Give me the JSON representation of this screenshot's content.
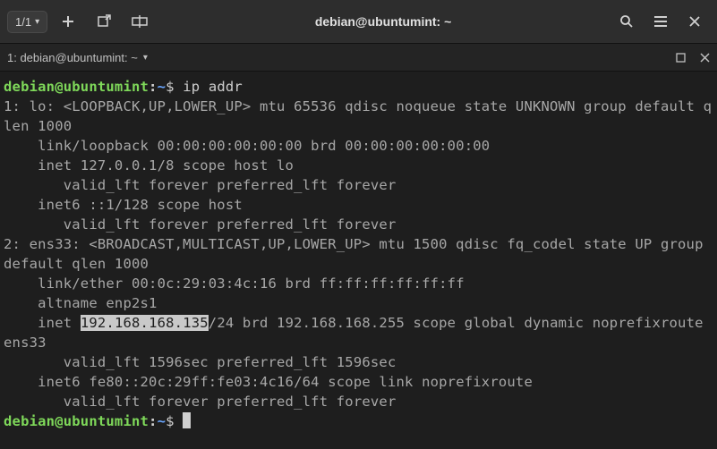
{
  "titlebar": {
    "tab_count": "1/1",
    "title": "debian@ubuntumint: ~"
  },
  "tabbar": {
    "label": "1: debian@ubuntumint: ~"
  },
  "prompt": {
    "user_host": "debian@ubuntumint",
    "path": "~",
    "dollar": "$"
  },
  "cmd1": "ip addr",
  "out": {
    "l1": "1: lo: <LOOPBACK,UP,LOWER_UP> mtu 65536 qdisc noqueue state UNKNOWN group default qlen 1000",
    "l2": "    link/loopback 00:00:00:00:00:00 brd 00:00:00:00:00:00",
    "l3": "    inet 127.0.0.1/8 scope host lo",
    "l4": "       valid_lft forever preferred_lft forever",
    "l5": "    inet6 ::1/128 scope host",
    "l6": "       valid_lft forever preferred_lft forever",
    "l7": "2: ens33: <BROADCAST,MULTICAST,UP,LOWER_UP> mtu 1500 qdisc fq_codel state UP group default qlen 1000",
    "l8": "    link/ether 00:0c:29:03:4c:16 brd ff:ff:ff:ff:ff:ff",
    "l9": "    altname enp2s1",
    "l10a": "    inet ",
    "l10_hl": "192.168.168.135",
    "l10b": "/24 brd 192.168.168.255 scope global dynamic noprefixroute ens33",
    "l11": "       valid_lft 1596sec preferred_lft 1596sec",
    "l12": "    inet6 fe80::20c:29ff:fe03:4c16/64 scope link noprefixroute",
    "l13": "       valid_lft forever preferred_lft forever"
  }
}
